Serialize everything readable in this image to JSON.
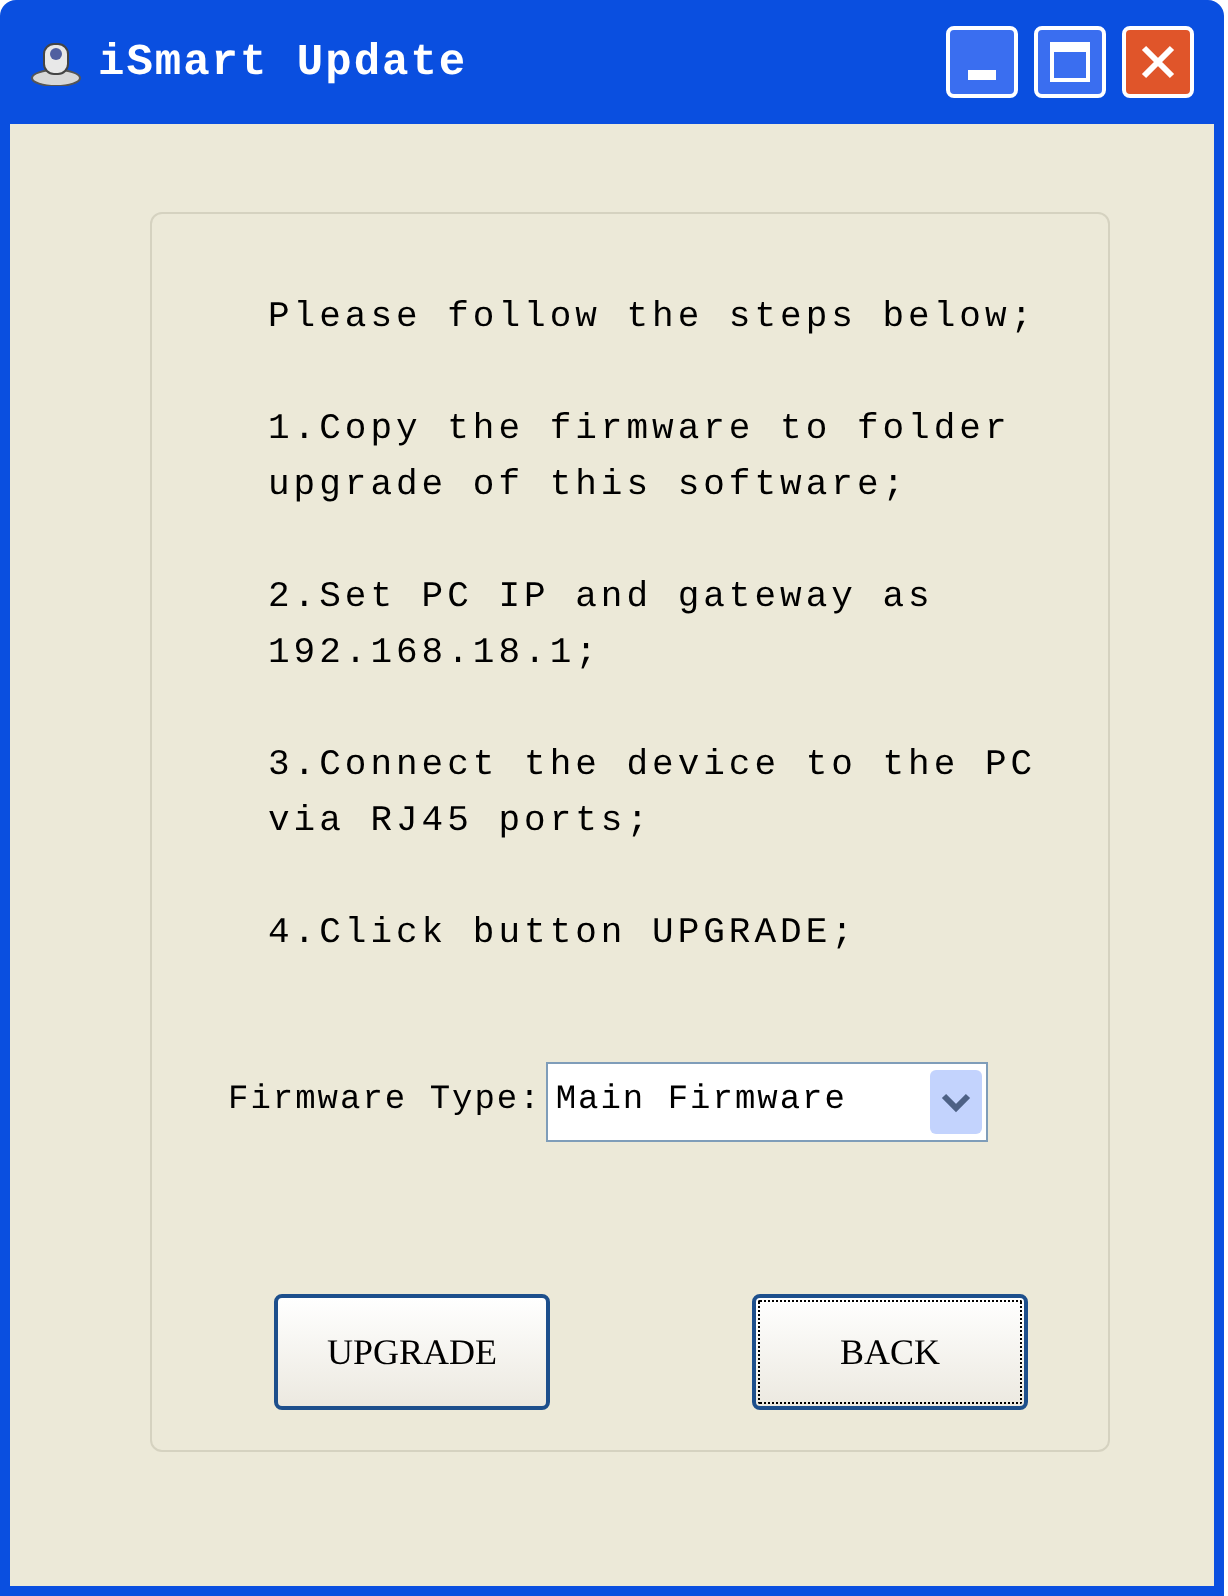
{
  "window": {
    "title": "iSmart Update"
  },
  "instructions": [
    "Please follow the steps below;",
    "1.Copy the firmware to folder upgrade of this software;",
    "2.Set PC IP and gateway as 192.168.18.1;",
    "3.Connect the device to the PC via RJ45 ports;",
    "4.Click button UPGRADE;"
  ],
  "firmware_type": {
    "label": "Firmware Type:",
    "value": "Main Firmware"
  },
  "buttons": [
    {
      "label": "UPGRADE",
      "focused": false
    },
    {
      "label": "BACK",
      "focused": true
    }
  ]
}
